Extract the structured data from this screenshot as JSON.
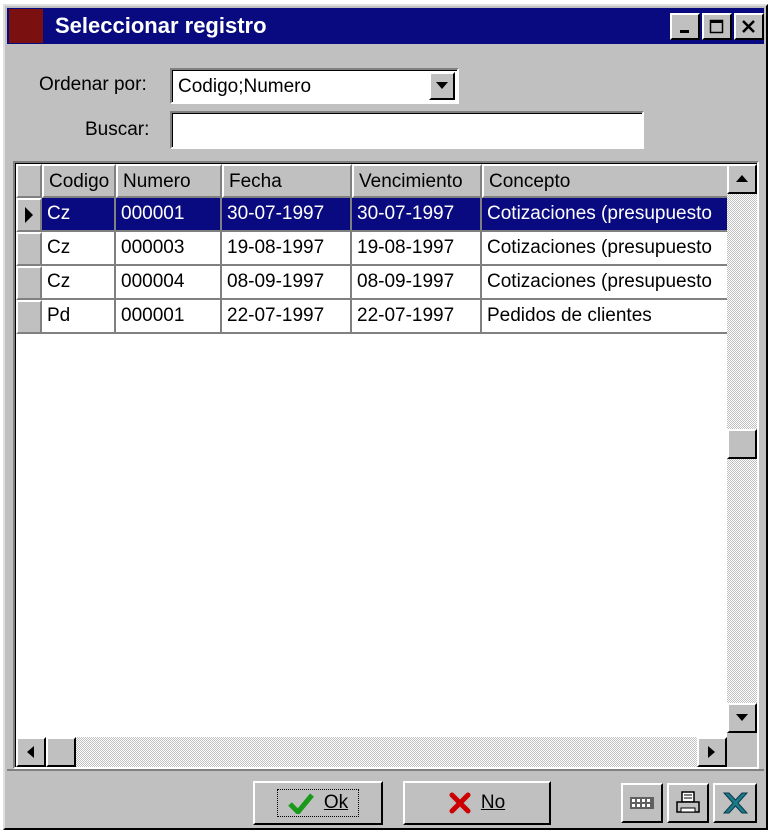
{
  "window": {
    "title": "Seleccionar registro",
    "buttons": [
      "minimize",
      "maximize",
      "close"
    ]
  },
  "form": {
    "order_label": "Ordenar por:",
    "order_value": "Codigo;Numero",
    "search_label": "Buscar:",
    "search_value": ""
  },
  "grid": {
    "columns": [
      "Codigo",
      "Numero",
      "Fecha",
      "Vencimiento",
      "Concepto"
    ],
    "rows": [
      {
        "codigo": "Cz",
        "numero": "000001",
        "fecha": "30-07-1997",
        "vencimiento": "30-07-1997",
        "concepto": "Cotizaciones (presupuesto",
        "selected": true
      },
      {
        "codigo": "Cz",
        "numero": "000003",
        "fecha": "19-08-1997",
        "vencimiento": "19-08-1997",
        "concepto": "Cotizaciones (presupuesto",
        "selected": false
      },
      {
        "codigo": "Cz",
        "numero": "000004",
        "fecha": "08-09-1997",
        "vencimiento": "08-09-1997",
        "concepto": "Cotizaciones (presupuesto",
        "selected": false
      },
      {
        "codigo": "Pd",
        "numero": "000001",
        "fecha": "22-07-1997",
        "vencimiento": "22-07-1997",
        "concepto": "Pedidos de clientes",
        "selected": false
      }
    ]
  },
  "buttons": {
    "ok_label": "Ok",
    "no_label": "No",
    "icons": [
      "calculator-icon",
      "printer-icon",
      "excel-icon"
    ]
  },
  "colors": {
    "titlebar": "#0a0a80",
    "selection": "#0a0a80",
    "face": "#c0c0c0"
  }
}
